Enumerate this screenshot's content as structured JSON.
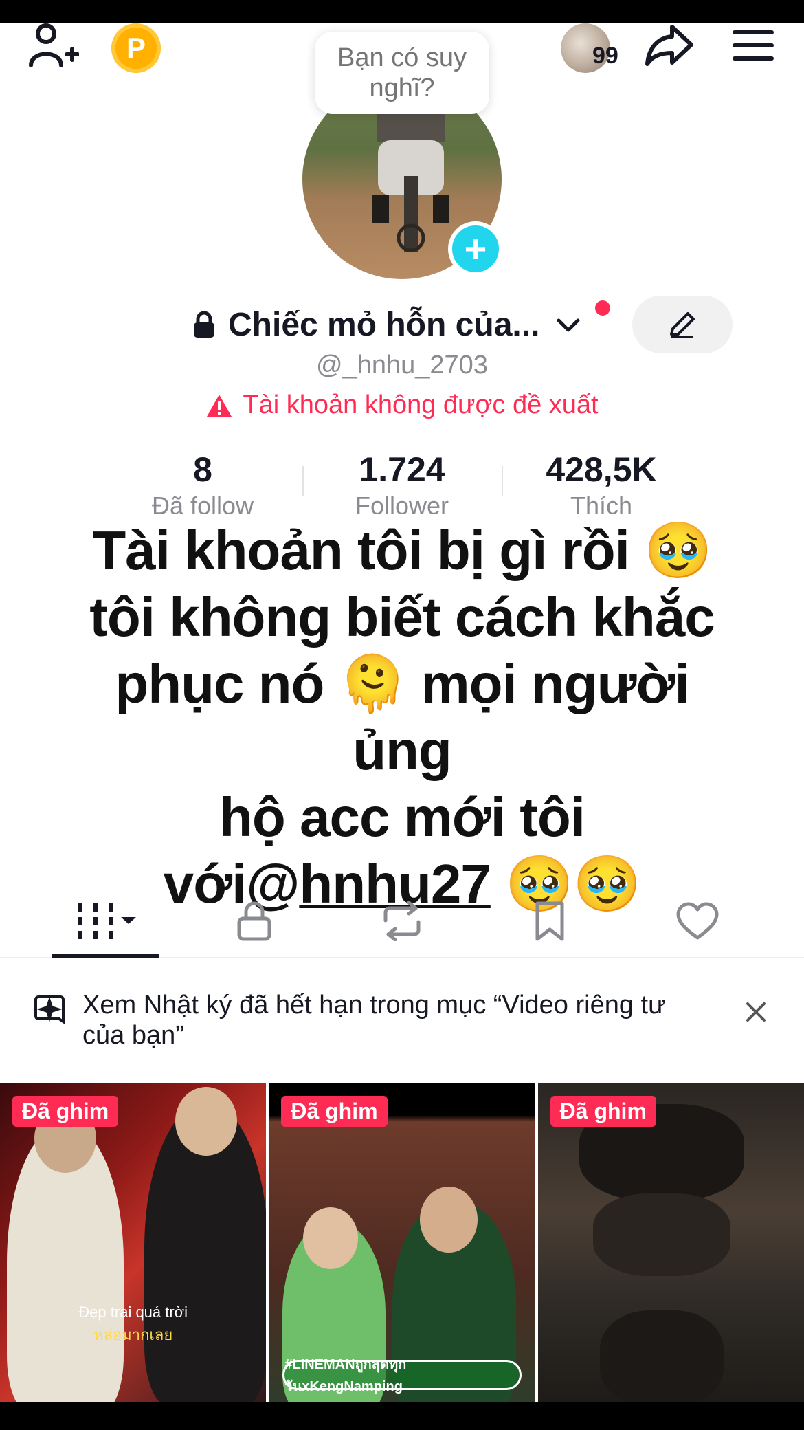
{
  "header": {
    "coin_label": "P",
    "notification_count": "99",
    "thought_bubble": "Bạn có suy nghĩ?"
  },
  "profile": {
    "display_name": "Chiếc mỏ hỗn của...",
    "username": "@_hnhu_2703",
    "warning": "Tài khoản không được đề xuất"
  },
  "stats": [
    {
      "value": "8",
      "label": "Đã follow"
    },
    {
      "value": "1.724",
      "label": "Follower"
    },
    {
      "value": "428,5K",
      "label": "Thích"
    }
  ],
  "overlay": {
    "line1": "Tài khoản tôi bị gì rồi 🥹",
    "line2": "tôi không biết cách khắc",
    "line3": "phục nó 🫠 mọi người ủng",
    "line4": "hộ acc mới tôi",
    "line5_prefix": "với@",
    "line5_mention": "hnhu27",
    "line5_suffix": " 🥹🥹"
  },
  "tabs": [
    "videos-tab",
    "private-tab",
    "reposts-tab",
    "favorites-tab",
    "liked-tab"
  ],
  "notice": {
    "text": "Xem Nhật ký đã hết hạn trong mục “Video riêng tư của bạn”"
  },
  "videos": [
    {
      "pin": "Đã ghim",
      "caption_line1": "Đẹp trai quá trời",
      "caption_line2": "หล่อมากเลย"
    },
    {
      "pin": "Đã ghim",
      "caption": "#LINEMANถูกสุดทุกวันxKengNamping"
    },
    {
      "pin": "Đã ghim"
    }
  ],
  "colors": {
    "accent_red": "#fe2c55",
    "cyan": "#20d5ec",
    "coin": "#ffb000"
  }
}
